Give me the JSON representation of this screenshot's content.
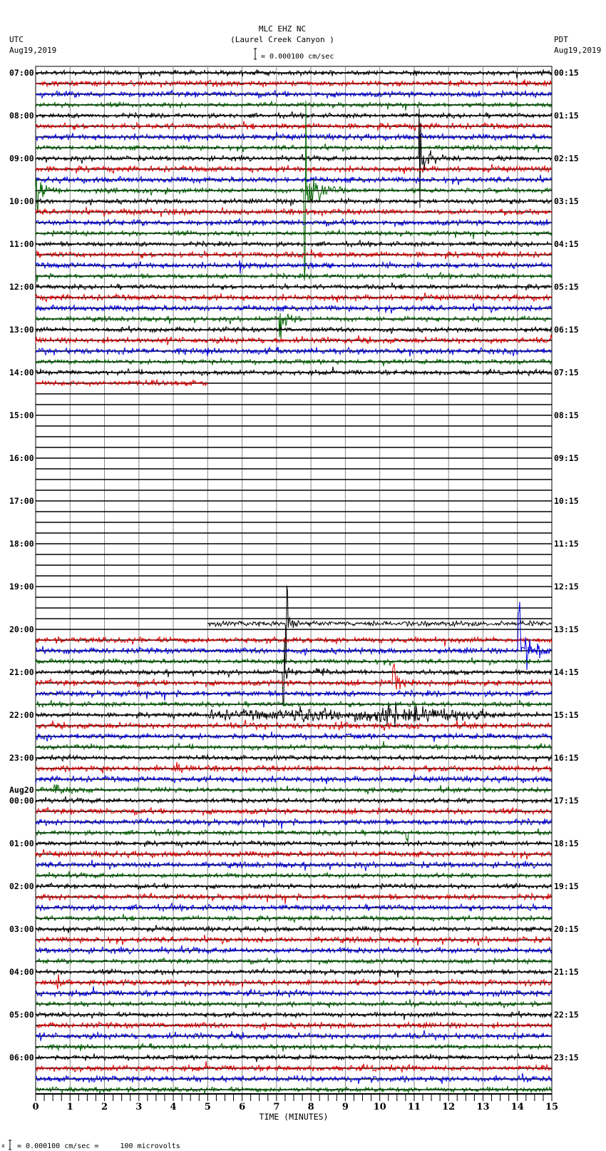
{
  "header": {
    "title": "MLC EHZ NC",
    "location": "(Laurel Creek Canyon )",
    "left_zone": "UTC",
    "left_date": "Aug19,2019",
    "right_zone": "PDT",
    "right_date": "Aug19,2019",
    "scale_text": "= 0.000100 cm/sec"
  },
  "footer": {
    "marker": "x",
    "text": "= 0.000100 cm/sec =     100 microvolts"
  },
  "chart_data": {
    "type": "line",
    "title": "MLC EHZ NC (Laurel Creek Canyon )",
    "xlabel": "TIME (MINUTES)",
    "xlim": [
      0,
      15
    ],
    "x_ticks": [
      "0",
      "1",
      "2",
      "3",
      "4",
      "5",
      "6",
      "7",
      "8",
      "9",
      "10",
      "11",
      "12",
      "13",
      "14",
      "15"
    ],
    "minutes_per_trace": 15,
    "trace_count": 96,
    "trace_colors": [
      "#000000",
      "#e00000",
      "#0000e0",
      "#006400"
    ],
    "left_labels": [
      "07:00",
      "08:00",
      "09:00",
      "10:00",
      "11:00",
      "12:00",
      "13:00",
      "14:00",
      "15:00",
      "16:00",
      "17:00",
      "18:00",
      "19:00",
      "20:00",
      "21:00",
      "22:00",
      "23:00",
      "00:00",
      "01:00",
      "02:00",
      "03:00",
      "04:00",
      "05:00",
      "06:00"
    ],
    "date_change_label": "Aug20",
    "date_change_hour_index": 17,
    "right_labels": [
      "00:15",
      "01:15",
      "02:15",
      "03:15",
      "04:15",
      "05:15",
      "06:15",
      "07:15",
      "08:15",
      "09:15",
      "10:15",
      "11:15",
      "12:15",
      "13:15",
      "14:15",
      "15:15",
      "16:15",
      "17:15",
      "18:15",
      "19:15",
      "20:15",
      "21:15",
      "22:15",
      "23:15"
    ],
    "data_gap": {
      "from_trace": 29,
      "from_minute": 5,
      "to_trace": 52,
      "to_minute": 5
    },
    "events": [
      {
        "trace": 8,
        "minute": 11.17,
        "spike": 70,
        "amp": 22,
        "dur": 0.3
      },
      {
        "trace": 11,
        "minute": 7.83,
        "spike": 125,
        "amp": 24,
        "dur": 0.5
      },
      {
        "trace": 11,
        "minute": 0.05,
        "spike": 18,
        "amp": 12,
        "dur": 0.3
      },
      {
        "trace": 12,
        "minute": 7.4,
        "spike": 0,
        "amp": 6,
        "dur": 0.15
      },
      {
        "trace": 13,
        "minute": 2.5,
        "spike": 0,
        "amp": 5,
        "dur": 0.1
      },
      {
        "trace": 18,
        "minute": 5.95,
        "spike": 10,
        "amp": 6,
        "dur": 0.1
      },
      {
        "trace": 23,
        "minute": 7.1,
        "spike": 25,
        "amp": 14,
        "dur": 0.3
      },
      {
        "trace": 52,
        "minute": 7.3,
        "spike": 55,
        "amp": 10,
        "dur": 0.2
      },
      {
        "trace": 54,
        "minute": 14.05,
        "spike": 55,
        "amp": 20,
        "dur": 0.5
      },
      {
        "trace": 56,
        "minute": 7.2,
        "spike": 45,
        "amp": 12,
        "dur": 0.2
      },
      {
        "trace": 56,
        "minute": 8.1,
        "spike": 0,
        "amp": 6,
        "dur": 0.3
      },
      {
        "trace": 57,
        "minute": 10.4,
        "spike": 22,
        "amp": 14,
        "dur": 0.3
      },
      {
        "trace": 60,
        "minute": 7.5,
        "spike": 0,
        "amp": 12,
        "dur": 0.6
      },
      {
        "trace": 60,
        "minute": 10.0,
        "spike": 0,
        "amp": 13,
        "dur": 1.5
      },
      {
        "trace": 61,
        "minute": 8.8,
        "spike": 0,
        "amp": 5,
        "dur": 0.4
      },
      {
        "trace": 65,
        "minute": 4.0,
        "spike": 0,
        "amp": 7,
        "dur": 0.2
      },
      {
        "trace": 67,
        "minute": 0.5,
        "spike": 0,
        "amp": 7,
        "dur": 0.6
      },
      {
        "trace": 71,
        "minute": 10.8,
        "spike": 8,
        "amp": 5,
        "dur": 0.1
      },
      {
        "trace": 85,
        "minute": 0.6,
        "spike": 0,
        "amp": 7,
        "dur": 0.4
      },
      {
        "trace": 85,
        "minute": 2.6,
        "spike": 0,
        "amp": 4,
        "dur": 0.2
      }
    ]
  }
}
